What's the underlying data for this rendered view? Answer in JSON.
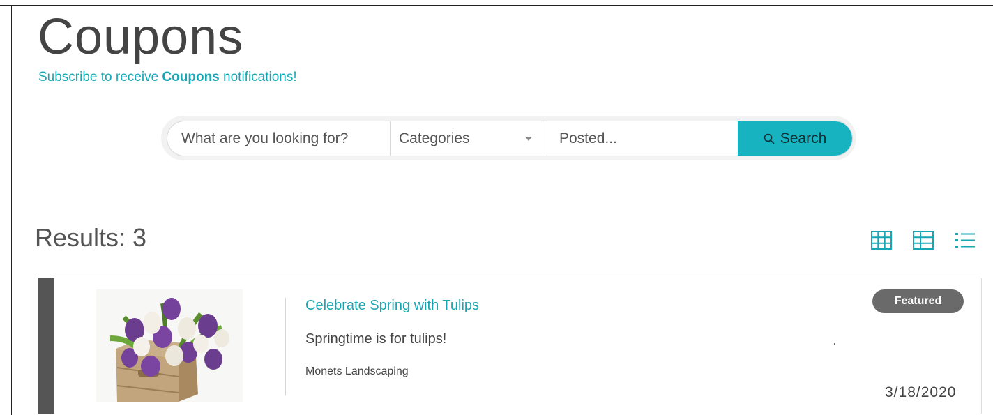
{
  "page": {
    "title": "Coupons",
    "subscribe": {
      "prefix": "Subscribe to receive ",
      "emphasis": "Coupons",
      "suffix": " notifications!"
    }
  },
  "search": {
    "keyword_placeholder": "What are you looking for?",
    "category_value": "Categories",
    "posted_placeholder": "Posted...",
    "button_label": "Search",
    "button_color": "#17b3c1"
  },
  "results": {
    "label": "Results: 3",
    "view_options": [
      "grid-view-icon",
      "table-view-icon",
      "list-view-icon"
    ],
    "active_view_color": "#17a6b3"
  },
  "listings": [
    {
      "title": "Celebrate Spring with Tulips",
      "description": "Springtime is for tulips!",
      "business": "Monets Landscaping",
      "badge": "Featured",
      "date": "3/18/2020",
      "image_icon": "tulips-photo"
    }
  ],
  "colors": {
    "accent": "#17a6b3",
    "card_accent": "#555555",
    "badge": "#6a6a6a"
  }
}
